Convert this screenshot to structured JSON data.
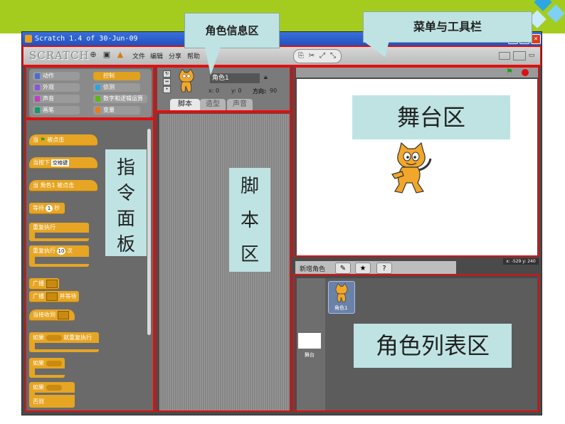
{
  "window": {
    "title": "Scratch 1.4 of 30-Jun-09",
    "controls": [
      "_",
      "□",
      "×"
    ]
  },
  "menubar": {
    "logo": "SCRATCH",
    "items": [
      "文件",
      "编辑",
      "分享",
      "帮助"
    ]
  },
  "palette": {
    "categories": [
      {
        "label": "动作",
        "color": "#4a6cd4"
      },
      {
        "label": "控制",
        "color": "#e1a91a",
        "selected": true
      },
      {
        "label": "外观",
        "color": "#8a55d7"
      },
      {
        "label": "侦测",
        "color": "#2ca5e2"
      },
      {
        "label": "声音",
        "color": "#bb42c3"
      },
      {
        "label": "数字和逻辑运算",
        "color": "#5cb712"
      },
      {
        "label": "画笔",
        "color": "#0e9a6c"
      },
      {
        "label": "变量",
        "color": "#ee7d16"
      }
    ],
    "blocks": {
      "when_flag_prefix": "当",
      "when_flag_suffix": "被点击",
      "when_key_prefix": "当按下",
      "when_key_value": "空格键",
      "when_sprite_clicked": "当 角色1 被点击",
      "wait_prefix": "等待",
      "wait_value": "1",
      "wait_suffix": "秒",
      "forever": "重复执行",
      "repeat_prefix": "重复执行",
      "repeat_value": "10",
      "repeat_suffix": "次",
      "broadcast": "广播",
      "broadcast_wait_prefix": "广播",
      "broadcast_wait_suffix": "并等待",
      "when_receive": "当接收到",
      "forever_if_prefix": "如果",
      "forever_if_suffix": "就重复执行",
      "if": "如果",
      "if_else": "如果",
      "else": "否则"
    }
  },
  "sprite_info": {
    "name": "角色1",
    "x": "x: 0",
    "y": "y: 0",
    "direction_label": "方向:",
    "direction_value": "90",
    "tabs": [
      "脚本",
      "造型",
      "声音"
    ]
  },
  "stage": {
    "xy_readout": "x: -529  y: 240"
  },
  "sprite_list": {
    "new_sprite_label": "新增角色",
    "sprite_name": "角色1",
    "stage_label": "舞台"
  },
  "annotations": {
    "sprite_info_area": "角色信息区",
    "menu_toolbar": "菜单与工具栏",
    "command_palette": [
      "指",
      "令",
      "面",
      "板"
    ],
    "script_area": [
      "脚",
      "本",
      "区"
    ],
    "stage_area": "舞台区",
    "sprite_list_area": "角色列表区"
  },
  "colors": {
    "highlight_border": "#e01010",
    "annotation_fill": "#bfe3e3",
    "top_band": "#a4cc1e",
    "block_control": "#e6a523"
  }
}
